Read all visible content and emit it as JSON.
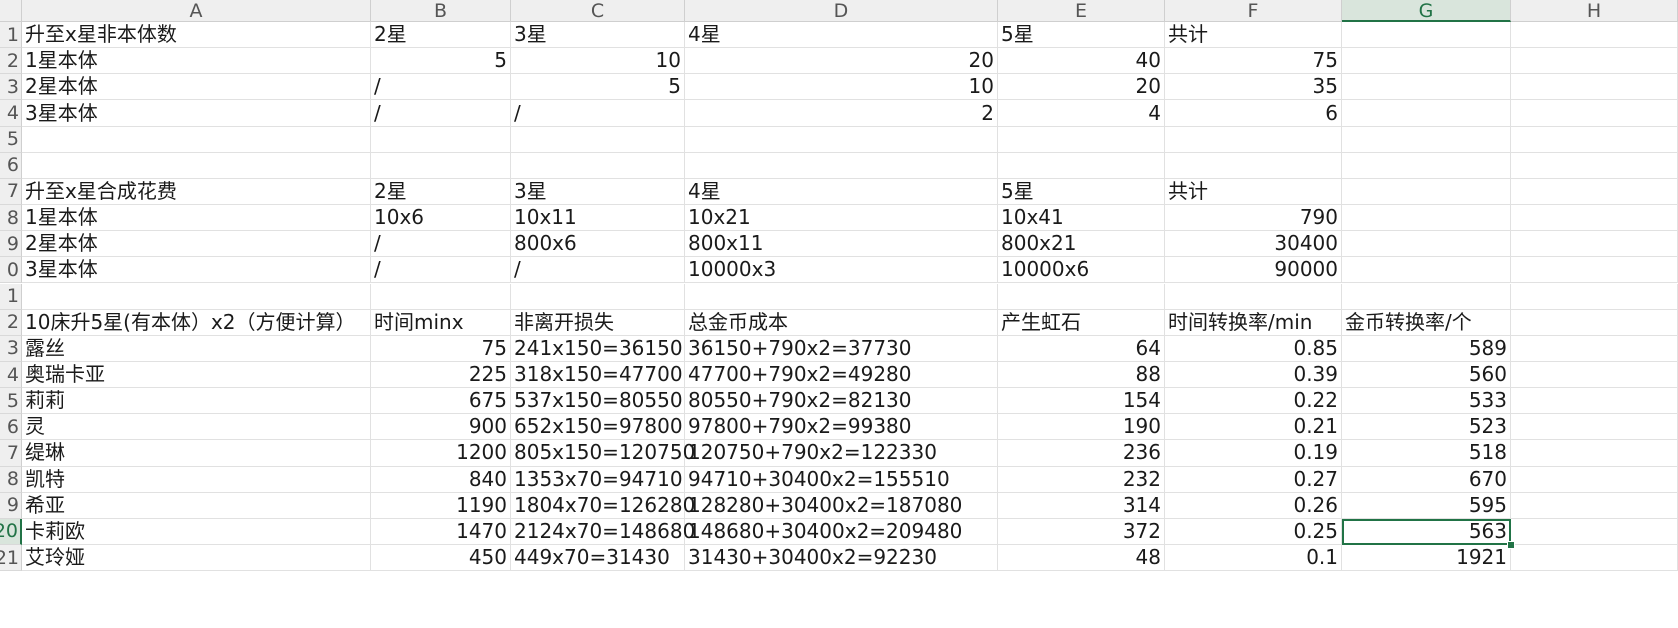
{
  "sheet": {
    "columns": [
      "A",
      "B",
      "C",
      "D",
      "E",
      "F",
      "G",
      "H"
    ],
    "rows": [
      "1",
      "2",
      "3",
      "4",
      "5",
      "6",
      "7",
      "8",
      "9",
      "0",
      "1",
      "2",
      "3",
      "4",
      "5",
      "6",
      "7",
      "8",
      "9",
      "20",
      "21"
    ],
    "active_column": "G",
    "active_row_index": 19,
    "grid": [
      [
        {
          "t": "升至x星非本体数"
        },
        {
          "t": "2星"
        },
        {
          "t": "3星"
        },
        {
          "t": "4星"
        },
        {
          "t": "5星"
        },
        {
          "t": "共计"
        },
        {
          "t": ""
        }
      ],
      [
        {
          "t": "1星本体"
        },
        {
          "t": "5",
          "n": true
        },
        {
          "t": "10",
          "n": true
        },
        {
          "t": "20",
          "n": true
        },
        {
          "t": "40",
          "n": true
        },
        {
          "t": "75",
          "n": true
        },
        {
          "t": ""
        }
      ],
      [
        {
          "t": "2星本体"
        },
        {
          "t": "/"
        },
        {
          "t": "5",
          "n": true
        },
        {
          "t": "10",
          "n": true
        },
        {
          "t": "20",
          "n": true
        },
        {
          "t": "35",
          "n": true
        },
        {
          "t": ""
        }
      ],
      [
        {
          "t": "3星本体"
        },
        {
          "t": "/"
        },
        {
          "t": "/"
        },
        {
          "t": "2",
          "n": true
        },
        {
          "t": "4",
          "n": true
        },
        {
          "t": "6",
          "n": true
        },
        {
          "t": ""
        }
      ],
      [
        {
          "t": ""
        },
        {
          "t": ""
        },
        {
          "t": ""
        },
        {
          "t": ""
        },
        {
          "t": ""
        },
        {
          "t": ""
        },
        {
          "t": ""
        }
      ],
      [
        {
          "t": ""
        },
        {
          "t": ""
        },
        {
          "t": ""
        },
        {
          "t": ""
        },
        {
          "t": ""
        },
        {
          "t": ""
        },
        {
          "t": ""
        }
      ],
      [
        {
          "t": "升至x星合成花费"
        },
        {
          "t": "2星"
        },
        {
          "t": "3星"
        },
        {
          "t": "4星"
        },
        {
          "t": "5星"
        },
        {
          "t": "共计"
        },
        {
          "t": ""
        }
      ],
      [
        {
          "t": "1星本体"
        },
        {
          "t": "10x6"
        },
        {
          "t": "10x11"
        },
        {
          "t": "10x21"
        },
        {
          "t": "10x41"
        },
        {
          "t": "790",
          "n": true
        },
        {
          "t": ""
        }
      ],
      [
        {
          "t": "2星本体"
        },
        {
          "t": "/"
        },
        {
          "t": "800x6"
        },
        {
          "t": "800x11"
        },
        {
          "t": "800x21"
        },
        {
          "t": "30400",
          "n": true
        },
        {
          "t": ""
        }
      ],
      [
        {
          "t": "3星本体"
        },
        {
          "t": "/"
        },
        {
          "t": "/"
        },
        {
          "t": "10000x3"
        },
        {
          "t": "10000x6"
        },
        {
          "t": "90000",
          "n": true
        },
        {
          "t": ""
        }
      ],
      [
        {
          "t": ""
        },
        {
          "t": ""
        },
        {
          "t": ""
        },
        {
          "t": ""
        },
        {
          "t": ""
        },
        {
          "t": ""
        },
        {
          "t": ""
        }
      ],
      [
        {
          "t": "10床升5星(有本体）x2（方便计算）"
        },
        {
          "t": "时间minx"
        },
        {
          "t": "非离开损失"
        },
        {
          "t": "总金币成本"
        },
        {
          "t": "产生虹石"
        },
        {
          "t": "时间转换率/min"
        },
        {
          "t": "金币转换率/个"
        }
      ],
      [
        {
          "t": "露丝"
        },
        {
          "t": "75",
          "n": true
        },
        {
          "t": "241x150=36150"
        },
        {
          "t": "36150+790x2=37730"
        },
        {
          "t": "64",
          "n": true
        },
        {
          "t": "0.85",
          "n": true
        },
        {
          "t": "589",
          "n": true
        }
      ],
      [
        {
          "t": "奥瑞卡亚"
        },
        {
          "t": "225",
          "n": true
        },
        {
          "t": "318x150=47700"
        },
        {
          "t": "47700+790x2=49280"
        },
        {
          "t": "88",
          "n": true
        },
        {
          "t": "0.39",
          "n": true
        },
        {
          "t": "560",
          "n": true
        }
      ],
      [
        {
          "t": "莉莉"
        },
        {
          "t": "675",
          "n": true
        },
        {
          "t": "537x150=80550"
        },
        {
          "t": "80550+790x2=82130"
        },
        {
          "t": "154",
          "n": true
        },
        {
          "t": "0.22",
          "n": true
        },
        {
          "t": "533",
          "n": true
        }
      ],
      [
        {
          "t": "灵"
        },
        {
          "t": "900",
          "n": true
        },
        {
          "t": "652x150=97800"
        },
        {
          "t": "97800+790x2=99380"
        },
        {
          "t": "190",
          "n": true
        },
        {
          "t": "0.21",
          "n": true
        },
        {
          "t": "523",
          "n": true
        }
      ],
      [
        {
          "t": "缇琳"
        },
        {
          "t": "1200",
          "n": true
        },
        {
          "t": "805x150=120750"
        },
        {
          "t": "120750+790x2=122330"
        },
        {
          "t": "236",
          "n": true
        },
        {
          "t": "0.19",
          "n": true
        },
        {
          "t": "518",
          "n": true
        }
      ],
      [
        {
          "t": "凯特"
        },
        {
          "t": "840",
          "n": true
        },
        {
          "t": "1353x70=94710"
        },
        {
          "t": "94710+30400x2=155510"
        },
        {
          "t": "232",
          "n": true
        },
        {
          "t": "0.27",
          "n": true
        },
        {
          "t": "670",
          "n": true
        }
      ],
      [
        {
          "t": "希亚"
        },
        {
          "t": "1190",
          "n": true
        },
        {
          "t": "1804x70=126280"
        },
        {
          "t": "128280+30400x2=187080"
        },
        {
          "t": "314",
          "n": true
        },
        {
          "t": "0.26",
          "n": true
        },
        {
          "t": "595",
          "n": true
        }
      ],
      [
        {
          "t": "卡莉欧"
        },
        {
          "t": "1470",
          "n": true
        },
        {
          "t": "2124x70=148680"
        },
        {
          "t": "148680+30400x2=209480"
        },
        {
          "t": "372",
          "n": true
        },
        {
          "t": "0.25",
          "n": true
        },
        {
          "t": "563",
          "n": true,
          "sel": true
        }
      ],
      [
        {
          "t": "艾玲娅"
        },
        {
          "t": "450",
          "n": true
        },
        {
          "t": "449x70=31430"
        },
        {
          "t": "31430+30400x2=92230"
        },
        {
          "t": "48",
          "n": true
        },
        {
          "t": "0.1",
          "n": true
        },
        {
          "t": "1921",
          "n": true
        }
      ]
    ]
  }
}
